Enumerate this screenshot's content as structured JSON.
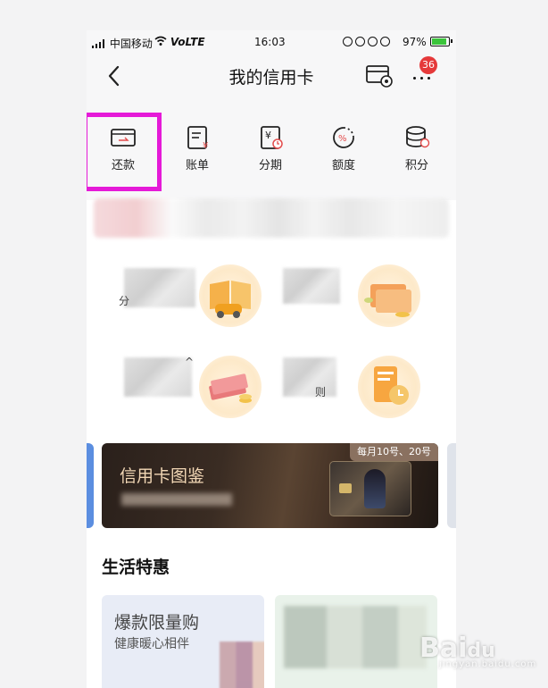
{
  "status_bar": {
    "carrier": "中国移动",
    "network": "VoLTE",
    "time": "16:03",
    "battery": "97%",
    "battery_level": 0.97
  },
  "header": {
    "title": "我的信用卡",
    "badge_count": "36"
  },
  "quick_actions": [
    {
      "label": "还款",
      "icon": "repay-card-icon"
    },
    {
      "label": "账单",
      "icon": "bill-icon"
    },
    {
      "label": "分期",
      "icon": "installment-icon"
    },
    {
      "label": "额度",
      "icon": "credit-limit-icon"
    },
    {
      "label": "积分",
      "icon": "points-icon"
    }
  ],
  "promo_tiles": [
    {
      "partial_text": "分"
    },
    {
      "partial_text": ""
    },
    {
      "partial_text": "^"
    },
    {
      "partial_text": "则"
    }
  ],
  "card_banner": {
    "title": "信用卡图鉴",
    "date_tag": "每月10号、20号"
  },
  "life_deals": {
    "section_title": "生活特惠",
    "offers": [
      {
        "title": "爆款限量购",
        "subtitle": "健康暖心相伴"
      }
    ]
  },
  "colors": {
    "highlight": "#e51ad8",
    "badge": "#e5393a",
    "accent_red": "#e34c4c"
  }
}
